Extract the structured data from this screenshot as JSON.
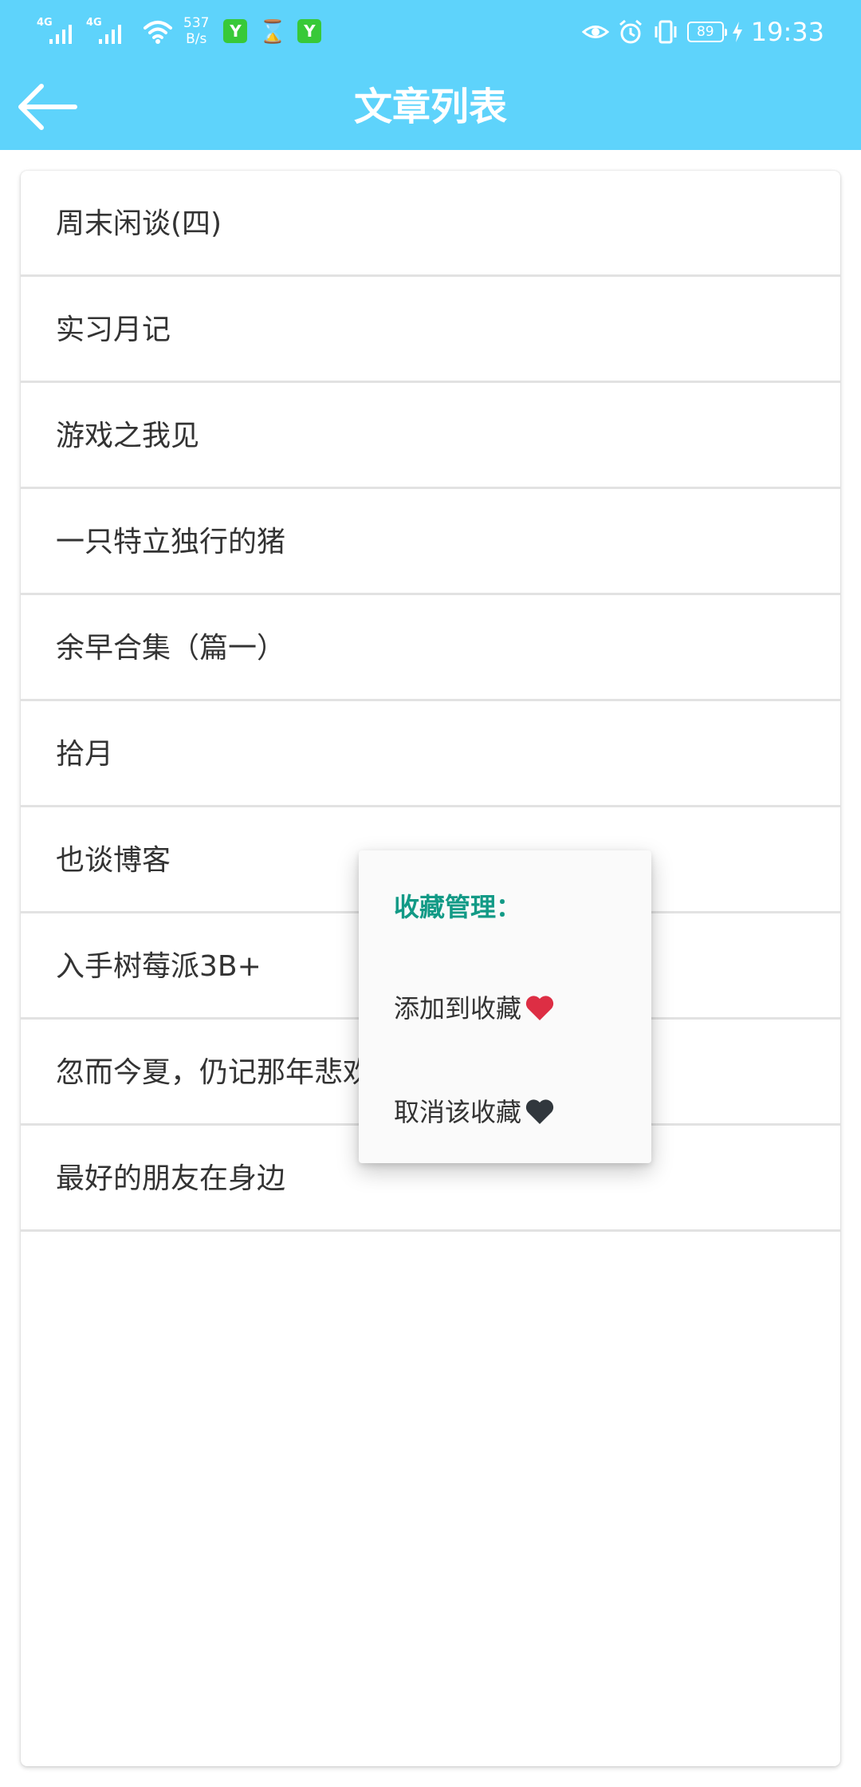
{
  "status_bar": {
    "network_labels": [
      "4G",
      "4G"
    ],
    "speed_value": "537",
    "speed_unit": "B/s",
    "app_badge": "Y",
    "hourglass_glyph": "⌛",
    "battery_level": "89",
    "time": "19:33"
  },
  "toolbar": {
    "title": "文章列表"
  },
  "articles": [
    "周末闲谈(四)",
    "实习月记",
    "游戏之我见",
    "一只特立独行的猪",
    "余早合集（篇一）",
    "拾月",
    "也谈博客",
    "入手树莓派3B+",
    "忽而今夏，仍记那年悲欢",
    "最好的朋友在身边"
  ],
  "context_menu": {
    "title": "收藏管理：",
    "items": [
      {
        "label": "添加到收藏",
        "icon": "red-heart-icon"
      },
      {
        "label": "取消该收藏",
        "icon": "black-heart-icon"
      }
    ]
  },
  "colors": {
    "primary": "#5ed3fb",
    "menu_title": "#129a86",
    "red_heart": "#dd2e44",
    "black_heart": "#31373d"
  }
}
